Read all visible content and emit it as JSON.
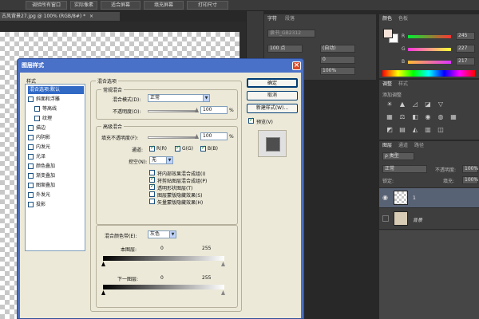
{
  "toolbar": {
    "items": [
      "调验所有窗口",
      "实际像素",
      "适合屏幕",
      "填充屏幕",
      "打印尺寸"
    ]
  },
  "doc_tab": {
    "title": "古风背景27.jpg @ 100% (RGB/8#) *",
    "close": "×"
  },
  "char_panel": {
    "tabs": [
      "字符",
      "段落"
    ],
    "font_family": "隶书_GB2312",
    "font_size": "100 点",
    "leading": "(自动)",
    "tracking": "0",
    "scale_v": "100%",
    "color_label": "颜色:",
    "aa_label": "aa",
    "aa_value": "浑厚"
  },
  "color_panel": {
    "tabs": [
      "颜色",
      "色板"
    ],
    "channels": [
      {
        "name": "R",
        "value": "245"
      },
      {
        "name": "G",
        "value": "227"
      },
      {
        "name": "B",
        "value": "217"
      }
    ],
    "colors": {
      "fg": "#f5e3d9",
      "bg": "#ffffff"
    }
  },
  "adjust_panel": {
    "tabs": [
      "调整",
      "样式"
    ],
    "title": "添加调整"
  },
  "layers_panel": {
    "tabs": [
      "图层",
      "通道",
      "路径"
    ],
    "kind": "ρ 类型",
    "blend": "正常",
    "opacity_label": "不透明度:",
    "opacity_value": "100%",
    "lock_label": "锁定:",
    "fill_label": "填充:",
    "fill_value": "100%",
    "layers": [
      {
        "name": "1"
      },
      {
        "name": "背景"
      }
    ]
  },
  "dialog": {
    "title": "图层样式",
    "close": "×",
    "sidebar_title": "样式",
    "sidebar_items": [
      {
        "label": "混合选项:默认",
        "checkbox": false
      },
      {
        "label": "斜面和浮雕",
        "checkbox": true
      },
      {
        "label": "等高线",
        "checkbox": true
      },
      {
        "label": "纹理",
        "checkbox": true
      },
      {
        "label": "描边",
        "checkbox": true
      },
      {
        "label": "内阴影",
        "checkbox": true
      },
      {
        "label": "内发光",
        "checkbox": true
      },
      {
        "label": "光泽",
        "checkbox": true
      },
      {
        "label": "颜色叠加",
        "checkbox": true
      },
      {
        "label": "渐变叠加",
        "checkbox": true
      },
      {
        "label": "图案叠加",
        "checkbox": true
      },
      {
        "label": "外发光",
        "checkbox": true
      },
      {
        "label": "投影",
        "checkbox": true
      }
    ],
    "blend_options": {
      "title": "混合选项",
      "general_title": "常规混合",
      "blend_mode_label": "混合模式(D):",
      "blend_mode": "正常",
      "opacity_label": "不透明度(O):",
      "opacity_value": "100",
      "percent": "%"
    },
    "advanced": {
      "title": "高级混合",
      "fill_opacity_label": "填充不透明度(F):",
      "fill_opacity_value": "100",
      "channels_label": "通道:",
      "channels": [
        "R(R)",
        "G(G)",
        "B(B)"
      ],
      "knockout_label": "挖空(N):",
      "knockout_value": "无",
      "options": [
        {
          "label": "将内部效果混合成组(I)",
          "checked": false
        },
        {
          "label": "将剪贴图层混合成组(P)",
          "checked": true
        },
        {
          "label": "透明形状图层(T)",
          "checked": true
        },
        {
          "label": "图层蒙版隐藏效果(S)",
          "checked": false
        },
        {
          "label": "矢量蒙版隐藏效果(H)",
          "checked": false
        }
      ]
    },
    "blend_if": {
      "label": "混合颜色带(E):",
      "value": "灰色",
      "this_layer": "本图层:",
      "underlying": "下一图层:",
      "min": "0",
      "max": "255"
    },
    "buttons": {
      "ok": "确定",
      "cancel": "取消",
      "new_style": "新建样式(W)...",
      "preview": "预览(V)"
    }
  }
}
